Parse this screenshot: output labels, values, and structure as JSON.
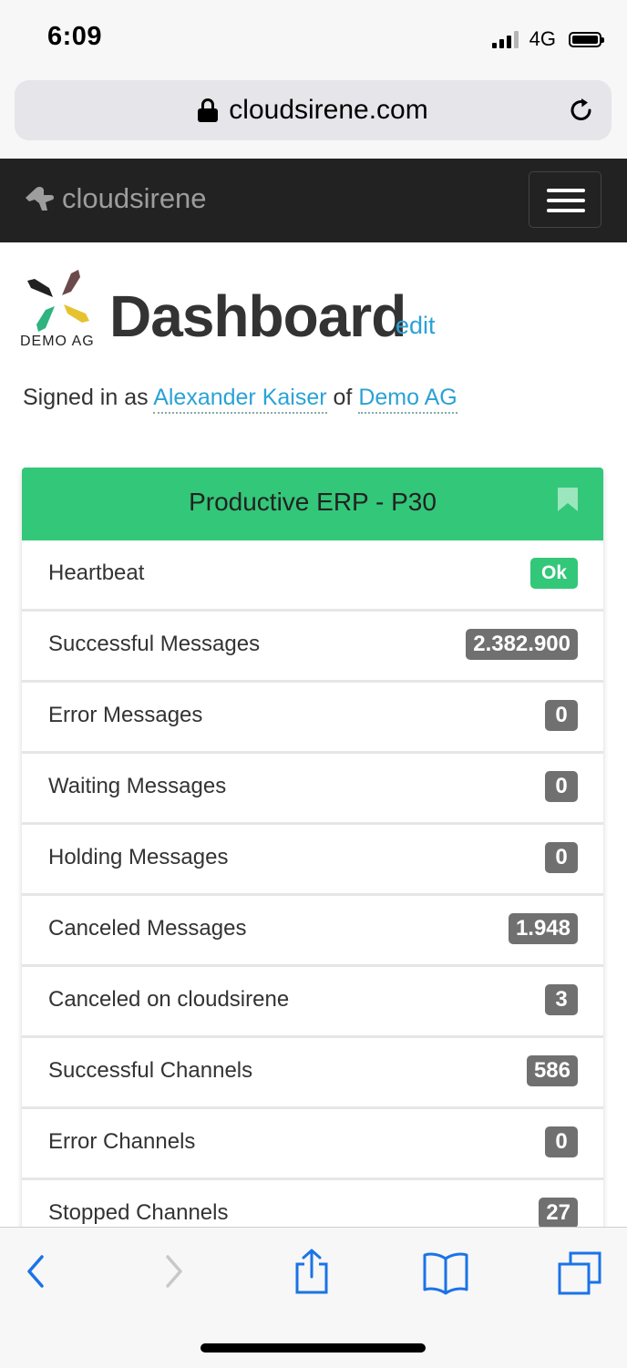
{
  "status_bar": {
    "time": "6:09",
    "network": "4G"
  },
  "browser": {
    "url": "cloudsirene.com"
  },
  "navbar": {
    "brand": "cloudsirene"
  },
  "header": {
    "logo_text": "DEMO AG",
    "title": "Dashboard",
    "edit_label": "edit",
    "signed_in_prefix": "Signed in as",
    "user_name": "Alexander Kaiser",
    "of_label": "of",
    "company": "Demo AG"
  },
  "card": {
    "title": "Productive ERP - P30",
    "rows": [
      {
        "label": "Heartbeat",
        "value": "Ok"
      },
      {
        "label": "Successful Messages",
        "value": "2.382.900"
      },
      {
        "label": "Error Messages",
        "value": "0"
      },
      {
        "label": "Waiting Messages",
        "value": "0"
      },
      {
        "label": "Holding Messages",
        "value": "0"
      },
      {
        "label": "Canceled Messages",
        "value": "1.948"
      },
      {
        "label": "Canceled on cloudsirene",
        "value": "3"
      },
      {
        "label": "Successful Channels",
        "value": "586"
      },
      {
        "label": "Error Channels",
        "value": "0"
      },
      {
        "label": "Stopped Channels",
        "value": "27"
      }
    ]
  },
  "colors": {
    "accent_green": "#33c779",
    "link_blue": "#2aa2d6",
    "navbar_bg": "#222222",
    "badge_gray": "#707070",
    "ios_blue": "#1a73e8"
  }
}
